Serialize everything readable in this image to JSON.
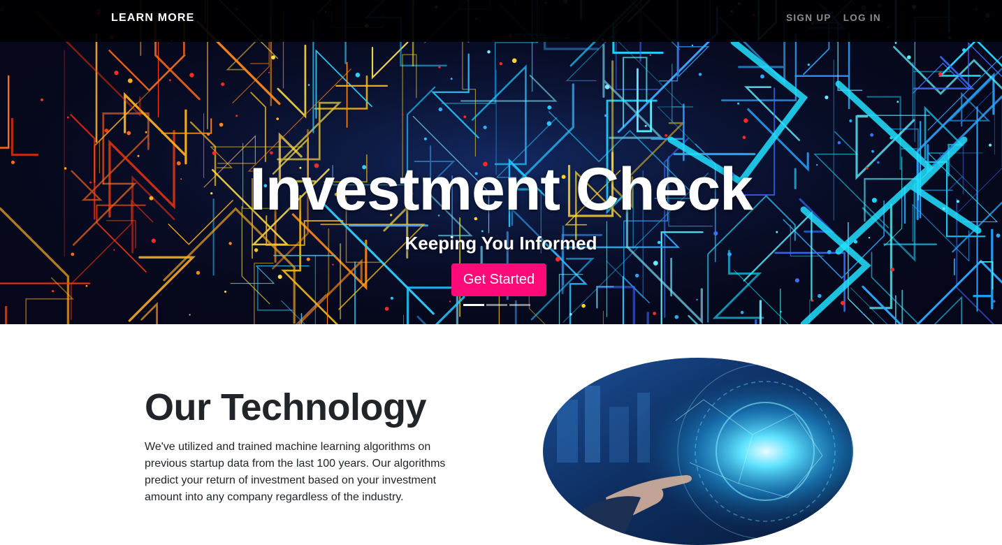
{
  "navbar": {
    "brand": "LEARN MORE",
    "links": [
      "SIGN UP",
      "LOG IN"
    ]
  },
  "hero": {
    "title": "Investment Check",
    "subtitle": "Keeping You Informed",
    "cta_label": "Get Started",
    "slides": 3,
    "active_slide": 1
  },
  "technology": {
    "heading": "Our Technology",
    "body": "We've utilized and trained machine learning algorithms on previous startup data from the last 100 years. Our algorithms predict your return of investment based on your investment amount into any company regardless of the industry."
  },
  "colors": {
    "navbar_bg": "#000000",
    "cta_bg": "#ff0a78",
    "text_dark": "#212529"
  },
  "icons": {
    "hero_background": "circuit-board-image",
    "tech_image": "digital-hand-network-image"
  }
}
